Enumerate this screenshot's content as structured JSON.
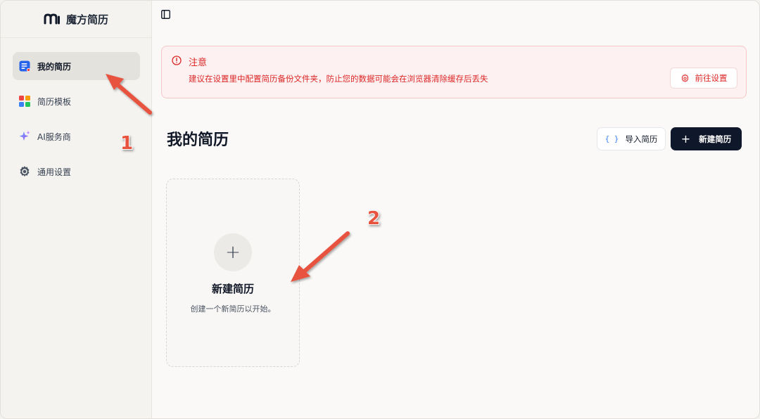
{
  "app": {
    "brand_name": "魔方简历"
  },
  "sidebar": {
    "items": [
      {
        "label": "我的简历",
        "icon": "resume-icon",
        "active": true
      },
      {
        "label": "简历模板",
        "icon": "template-grid-icon",
        "active": false
      },
      {
        "label": "AI服务商",
        "icon": "sparkle-icon",
        "active": false
      },
      {
        "label": "通用设置",
        "icon": "gear-icon",
        "active": false
      }
    ]
  },
  "alert": {
    "title": "注意",
    "message": "建议在设置里中配置简历备份文件夹，防止您的数据可能会在浏览器清除缓存后丢失",
    "action_label": "前往设置"
  },
  "main": {
    "title": "我的简历",
    "import_label": "导入简历",
    "import_icon": "{ }",
    "new_label": "新建简历",
    "new_icon": "+"
  },
  "new_card": {
    "plus": "+",
    "title": "新建简历",
    "subtitle": "创建一个新简历以开始。"
  },
  "annotations": [
    {
      "number": "1"
    },
    {
      "number": "2"
    }
  ],
  "colors": {
    "accent_red": "#dc2626",
    "primary_dark": "#0f172a",
    "annotation_red": "#e8533f"
  }
}
